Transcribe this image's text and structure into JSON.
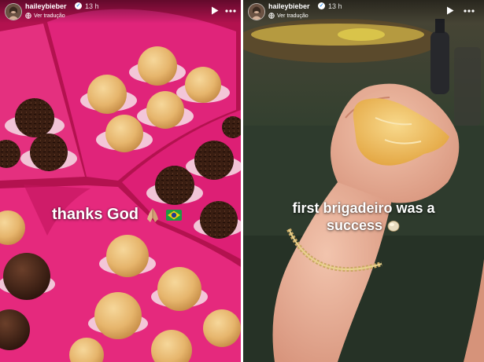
{
  "left_story": {
    "username": "haileybieber",
    "timeago": "13 h",
    "translate_label": "Ver tradução",
    "caption": "thanks God",
    "icons": [
      "avatar",
      "verified-badge-icon",
      "translate-icon",
      "play-icon",
      "more-icon",
      "prayer-hands-emoji-icon",
      "brazil-flag-emoji-icon"
    ]
  },
  "right_story": {
    "username": "haileybieber",
    "timeago": "13 h",
    "translate_label": "Ver tradução",
    "caption_line1": "first brigadeiro was a",
    "caption_line2": "success",
    "icons": [
      "avatar",
      "verified-badge-icon",
      "translate-icon",
      "play-icon",
      "more-icon",
      "brigadeiro-emoji-icon"
    ]
  },
  "colors": {
    "tray_pink": "#e0247a",
    "header_text": "#ffffff",
    "verified_blue": "#3897f0"
  }
}
